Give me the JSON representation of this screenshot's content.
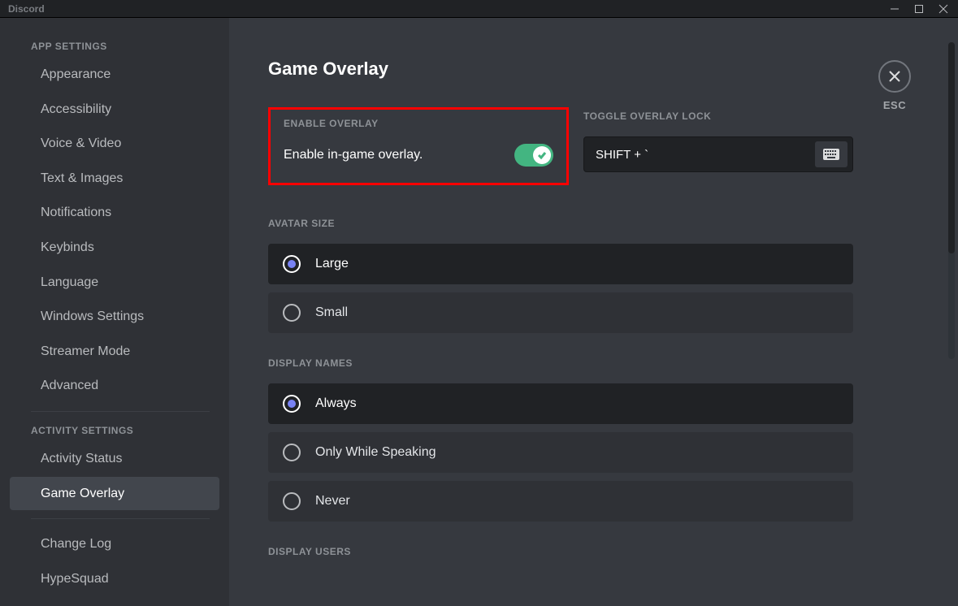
{
  "titlebar": {
    "app_name": "Discord"
  },
  "close": {
    "esc_label": "ESC"
  },
  "sidebar": {
    "heading_app": "APP SETTINGS",
    "heading_activity": "ACTIVITY SETTINGS",
    "items_app": [
      "Appearance",
      "Accessibility",
      "Voice & Video",
      "Text & Images",
      "Notifications",
      "Keybinds",
      "Language",
      "Windows Settings",
      "Streamer Mode",
      "Advanced"
    ],
    "items_activity": [
      "Activity Status",
      "Game Overlay"
    ],
    "items_tail": [
      "Change Log",
      "HypeSquad"
    ]
  },
  "page": {
    "title": "Game Overlay",
    "enable_heading": "ENABLE OVERLAY",
    "enable_label": "Enable in-game overlay.",
    "enable_value": true,
    "lock_heading": "TOGGLE OVERLAY LOCK",
    "lock_keybind": "SHIFT + `",
    "avatar_heading": "AVATAR SIZE",
    "avatar_options": [
      "Large",
      "Small"
    ],
    "avatar_selected": "Large",
    "display_names_heading": "DISPLAY NAMES",
    "display_names_options": [
      "Always",
      "Only While Speaking",
      "Never"
    ],
    "display_names_selected": "Always",
    "display_users_heading": "DISPLAY USERS"
  },
  "colors": {
    "accent": "#43b581",
    "highlight": "#ff0000"
  }
}
